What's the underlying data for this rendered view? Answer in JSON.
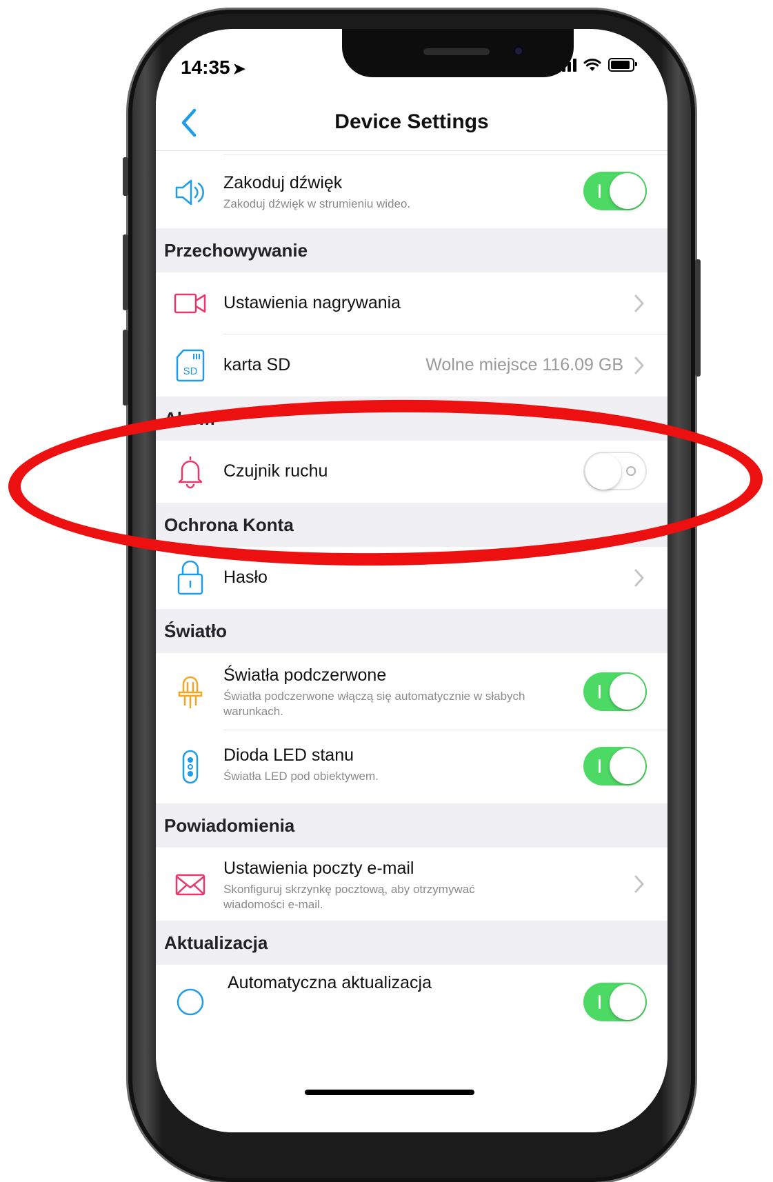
{
  "status": {
    "time": "14:35"
  },
  "nav": {
    "title": "Device Settings"
  },
  "rows": {
    "encode_audio": {
      "title": "Zakoduj dźwięk",
      "subtitle": "Zakoduj dźwięk w strumieniu wideo.",
      "enabled": true,
      "icon": "speaker-icon"
    },
    "recording": {
      "title": "Ustawienia nagrywania",
      "icon": "video-camera-icon"
    },
    "sd_card": {
      "title": "karta SD",
      "value": "Wolne miejsce 116.09 GB",
      "icon": "sd-card-icon"
    },
    "motion": {
      "title": "Czujnik ruchu",
      "enabled": false,
      "icon": "bell-icon"
    },
    "password": {
      "title": "Hasło",
      "icon": "lock-icon"
    },
    "infrared": {
      "title": "Światła podczerwone",
      "subtitle": "Światła podczerwone włączą się automatycznie w słabych warunkach.",
      "enabled": true,
      "icon": "infrared-bulb-icon"
    },
    "status_led": {
      "title": "Dioda LED stanu",
      "subtitle": "Światła LED pod obiektywem.",
      "enabled": true,
      "icon": "led-icon"
    },
    "email": {
      "title": "Ustawienia poczty e-mail",
      "subtitle": "Skonfiguruj skrzynkę pocztową, aby otrzymywać wiadomości e-mail.",
      "icon": "mail-icon"
    },
    "auto_update": {
      "title": "Automatyczna aktualizacja",
      "enabled": true
    }
  },
  "sections": {
    "storage": "Przechowywanie",
    "alarm": "Alarm",
    "account": "Ochrona Konta",
    "light": "Światło",
    "notifications": "Powiadomienia",
    "update": "Aktualizacja"
  },
  "colors": {
    "toggle_on": "#4cd964",
    "accent_blue": "#1e9be9",
    "accent_pink": "#e8386a",
    "accent_orange": "#f5a623",
    "annotation_red": "#ec1010"
  }
}
